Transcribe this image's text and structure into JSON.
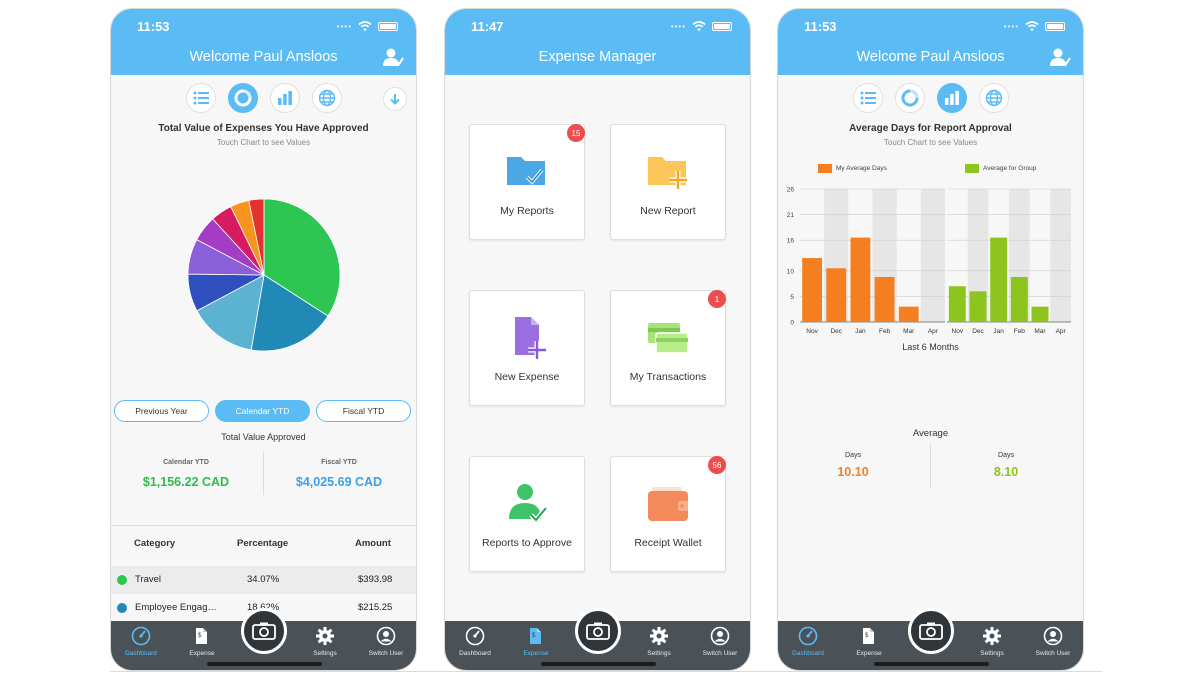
{
  "colors": {
    "accent": "#5bbcf5",
    "tabbar": "#4a5258",
    "orange": "#f57f20",
    "green": "#8dc41e",
    "income": "#2dbd4f",
    "fiscal": "#3aa0e8",
    "badge": "#ee4d4d"
  },
  "phone1": {
    "status_time": "11:53",
    "header_title": "Welcome Paul Ansloos",
    "chart_title": "Total Value of Expenses You Have Approved",
    "chart_subtitle": "Touch Chart to see Values",
    "period_buttons": [
      "Previous Year",
      "Calendar YTD",
      "Fiscal YTD"
    ],
    "selected_period": "Calendar YTD",
    "total_caption": "Total Value Approved",
    "stats": [
      {
        "label": "Calendar YTD",
        "value": "$1,156.22 CAD"
      },
      {
        "label": "Fiscal YTD",
        "value": "$4,025.69 CAD"
      }
    ],
    "table_headers": [
      "Category",
      "Percentage",
      "Amount"
    ],
    "table_rows": [
      {
        "category": "Travel",
        "percentage": "34.07%",
        "amount": "$393.98",
        "color": "#2dc653"
      },
      {
        "category": "Employee Engag…",
        "percentage": "18.62%",
        "amount": "$215.25",
        "color": "#2189b5"
      }
    ]
  },
  "phone2": {
    "status_time": "11:47",
    "header_title": "Expense Manager",
    "tiles": [
      {
        "label": "My Reports",
        "badge": "15",
        "icon": "folder-check-icon"
      },
      {
        "label": "New Report",
        "badge": "",
        "icon": "folder-plus-icon"
      },
      {
        "label": "New Expense",
        "badge": "",
        "icon": "document-plus-icon"
      },
      {
        "label": "My Transactions",
        "badge": "1",
        "icon": "cards-icon"
      },
      {
        "label": "Reports to Approve",
        "badge": "",
        "icon": "user-check-icon"
      },
      {
        "label": "Receipt Wallet",
        "badge": "56",
        "icon": "wallet-icon"
      }
    ]
  },
  "phone3": {
    "status_time": "11:53",
    "header_title": "Welcome Paul Ansloos",
    "chart_title": "Average Days for Report Approval",
    "chart_subtitle": "Touch Chart to see Values",
    "x_caption": "Last 6 Months",
    "average_label": "Average",
    "stats": [
      {
        "label": "Days",
        "value": "10.10"
      },
      {
        "label": "Days",
        "value": "8.10"
      }
    ]
  },
  "tabs": [
    "Dashboard",
    "Expense",
    "Settings",
    "Switch User"
  ],
  "chart_data": [
    {
      "type": "pie",
      "title": "Total Value of Expenses You Have Approved",
      "subtitle": "Touch Chart to see Values",
      "slices": [
        {
          "value": 34.07,
          "color": "#2dc653"
        },
        {
          "value": 18.62,
          "color": "#2189b5"
        },
        {
          "value": 14.5,
          "color": "#5bb3d1"
        },
        {
          "value": 8.0,
          "color": "#2f4fbf"
        },
        {
          "value": 7.5,
          "color": "#8b5fd8"
        },
        {
          "value": 5.5,
          "color": "#a43cc4"
        },
        {
          "value": 4.6,
          "color": "#d81b60"
        },
        {
          "value": 4.0,
          "color": "#f7941d"
        },
        {
          "value": 3.2,
          "color": "#e53030"
        }
      ]
    },
    {
      "type": "bar",
      "title": "Average Days for Report Approval",
      "subtitle": "Touch Chart to see Values",
      "xlabel": "Last 6 Months",
      "categories": [
        "Nov",
        "Dec",
        "Jan",
        "Feb",
        "Mar",
        "Apr"
      ],
      "ylim": [
        0,
        26
      ],
      "yticks": [
        "0",
        "5",
        "10",
        "16",
        "21",
        "26"
      ],
      "series": [
        {
          "name": "My Average Days",
          "color": "#f57f20",
          "values": [
            12.5,
            10.5,
            16.5,
            8.8,
            3.0,
            0
          ]
        },
        {
          "name": "Average for Group",
          "color": "#8dc41e",
          "values": [
            7,
            6,
            16.5,
            8.8,
            3.0,
            0
          ]
        }
      ]
    }
  ]
}
